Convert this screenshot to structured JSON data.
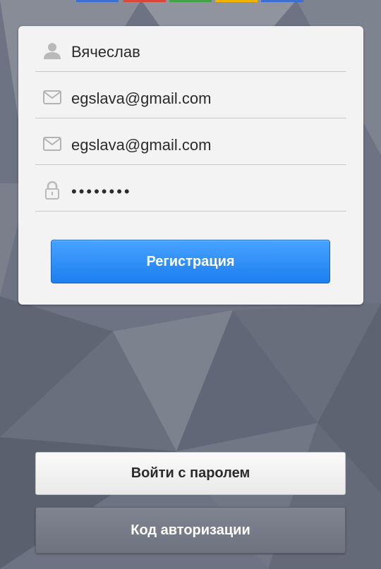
{
  "form": {
    "name": {
      "value": "Вячеслав",
      "icon": "person-icon"
    },
    "email": {
      "value": "egslava@gmail.com",
      "icon": "envelope-icon"
    },
    "email_confirm": {
      "value": "egslava@gmail.com",
      "icon": "envelope-icon"
    },
    "password": {
      "value": "••••••••",
      "icon": "lock-icon"
    },
    "register_label": "Регистрация"
  },
  "actions": {
    "login_with_password_label": "Войти с паролем",
    "auth_code_label": "Код авторизации"
  },
  "colors": {
    "background": "#6f7583",
    "card": "#f3f3f3",
    "primary": "#2f8cf6",
    "top_strip": [
      "#3b6fd1",
      "#d9473b",
      "#43a047",
      "#f0b400",
      "#3b6fd1"
    ]
  }
}
